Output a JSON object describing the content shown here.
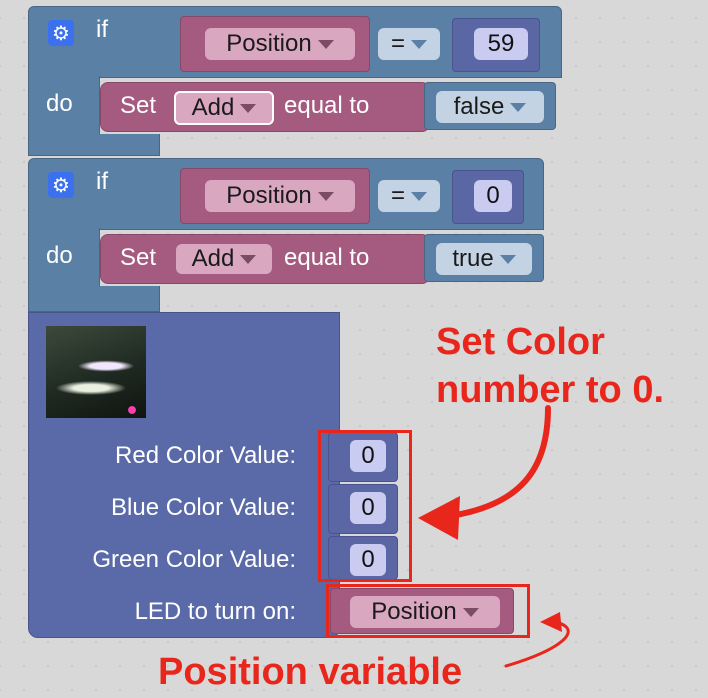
{
  "block1": {
    "if_label": "if",
    "do_label": "do",
    "cond_var": "Position",
    "operator": "=",
    "value": "59",
    "set_label": "Set",
    "set_var": "Add",
    "equal_to_label": "equal to",
    "set_value": "false"
  },
  "block2": {
    "if_label": "if",
    "do_label": "do",
    "cond_var": "Position",
    "operator": "=",
    "value": "0",
    "set_label": "Set",
    "set_var": "Add",
    "equal_to_label": "equal to",
    "set_value": "true"
  },
  "led_block": {
    "red_label": "Red Color Value:",
    "red_value": "0",
    "blue_label": "Blue Color Value:",
    "blue_value": "0",
    "green_label": "Green Color Value:",
    "green_value": "0",
    "led_label": "LED to turn on:",
    "led_var": "Position"
  },
  "annotations": {
    "set_color": "Set Color number to 0.",
    "position_variable": "Position variable"
  },
  "colors": {
    "logic_block": "#5b80a5",
    "variable_block": "#a55b80",
    "led_block": "#5a6aa8",
    "annotation": "#e8261b",
    "gear_icon": "#3b71ee"
  }
}
